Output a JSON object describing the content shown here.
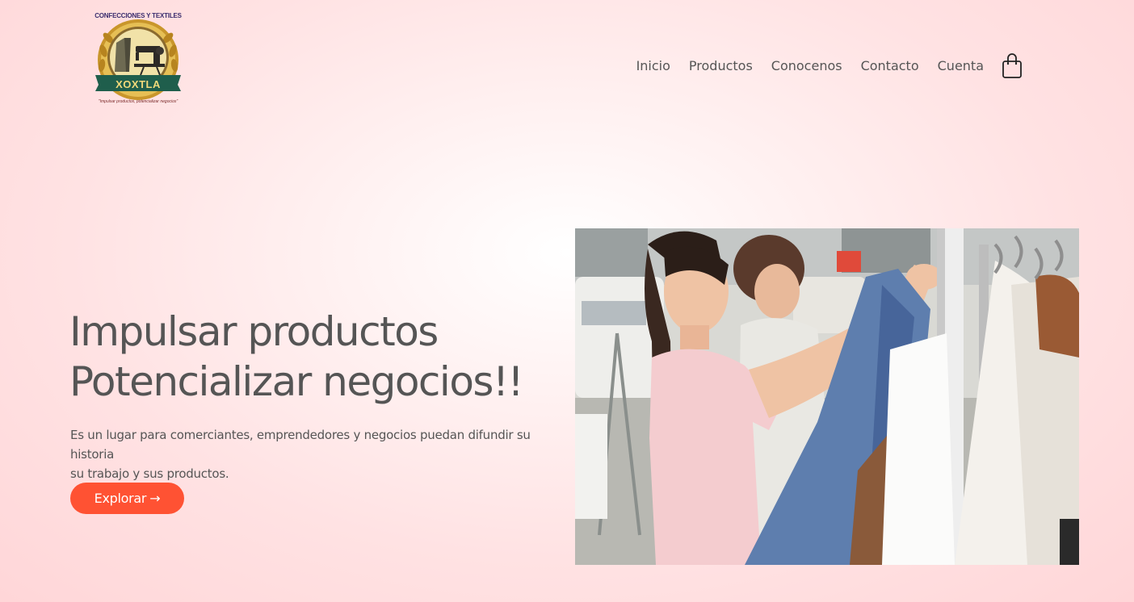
{
  "brand": {
    "top_text": "CONFECCIONES Y TEXTILES",
    "name": "XOXTLA",
    "slogan": "\"Impulsar productos, potencializar negocios\""
  },
  "nav": {
    "items": [
      {
        "label": "Inicio"
      },
      {
        "label": "Productos"
      },
      {
        "label": "Conocenos"
      },
      {
        "label": "Contacto"
      },
      {
        "label": "Cuenta"
      }
    ],
    "cart_icon": "shopping-bag-icon"
  },
  "hero": {
    "title_line1": "Impulsar productos",
    "title_line2": "Potencializar negocios!!",
    "description_line1": "Es un lugar para comerciantes, emprendedores y negocios puedan difundir su historia",
    "description_line2": "su trabajo y sus productos.",
    "button_label": "Explorar",
    "button_arrow": "→"
  },
  "colors": {
    "accent": "#ff5233",
    "text": "#555555",
    "background": "#ffe2e3",
    "logo_band": "#1f5e4c",
    "logo_gold": "#d4a436"
  }
}
